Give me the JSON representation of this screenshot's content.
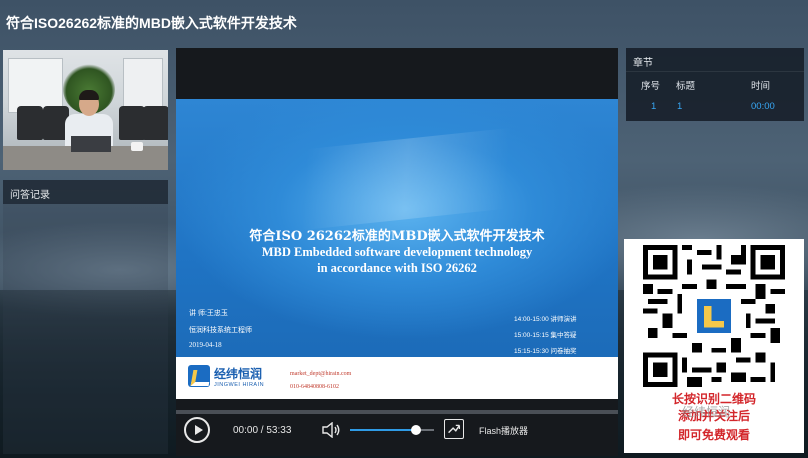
{
  "page": {
    "title": "符合ISO26262标准的MBD嵌入式软件开发技术"
  },
  "left_panel": {
    "qa_label": "问答记录"
  },
  "slide": {
    "title_cn": "符合ISO 26262标准的MBD嵌入式软件开发技术",
    "title_en_line1": "MBD Embedded software development technology",
    "title_en_line2": "in accordance with ISO 26262",
    "speaker": "讲 师:王忠玉",
    "speaker_role": "恒润科技系统工程师",
    "date": "2019-04-18",
    "schedule": [
      "14:00-15:00  讲师演讲",
      "15:00-15:15  集中答疑",
      "15:15-15:30  问卷抽奖"
    ],
    "logo_cn": "经纬恒润",
    "logo_en": "JINGWEI HIRAIN",
    "email": "market_dept@hirain.com",
    "phone": "010-64840808-6102"
  },
  "player": {
    "time_display": "00:00 / 53:33",
    "flash_label": "Flash播放器",
    "progress": 0,
    "volume": 0.78,
    "icons": {
      "play": "play-icon",
      "volume": "volume-icon",
      "flash": "flash-player-icon"
    }
  },
  "chapters": {
    "title": "章节",
    "headers": [
      "序号",
      "标题",
      "时间"
    ],
    "rows": [
      {
        "index": "1",
        "title": "1",
        "time": "00:00"
      }
    ]
  },
  "qr_overlay": {
    "caption_line1": "长按识别二维码",
    "caption_line2": "添加并关注后",
    "caption_line3": "即可免费观看",
    "watermark": "经纬恒润"
  },
  "colors": {
    "accent_blue": "#38a8f5",
    "qr_caption_red": "#d3262b",
    "slide_blue": "#2e86d4"
  }
}
